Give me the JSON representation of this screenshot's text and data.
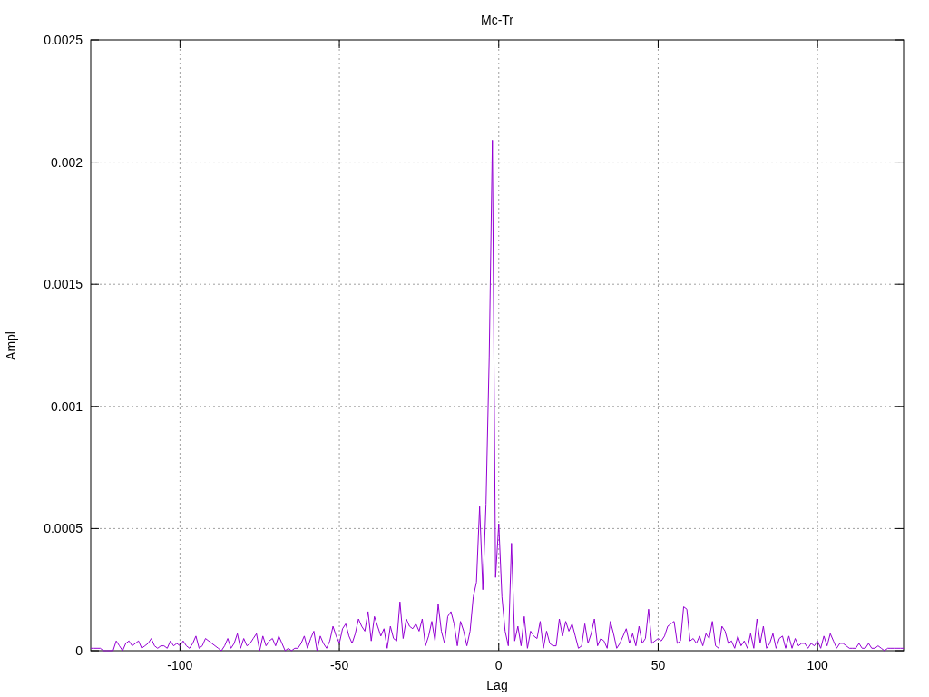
{
  "chart_data": {
    "type": "line",
    "title": "Mc-Tr",
    "xlabel": "Lag",
    "ylabel": "Ampl",
    "grid": true,
    "xlim": [
      -128,
      127
    ],
    "ylim": [
      0,
      0.0025
    ],
    "xticks": [
      -100,
      -50,
      0,
      50,
      100
    ],
    "yticks": [
      {
        "value": 0,
        "label": "0"
      },
      {
        "value": 0.0005,
        "label": "0.0005"
      },
      {
        "value": 0.001,
        "label": "0.001"
      },
      {
        "value": 0.0015,
        "label": "0.0015"
      },
      {
        "value": 0.002,
        "label": "0.002"
      },
      {
        "value": 0.0025,
        "label": "0.0025"
      }
    ],
    "x": [
      -128,
      -127,
      -126,
      -125,
      -124,
      -123,
      -122,
      -121,
      -120,
      -119,
      -118,
      -117,
      -116,
      -115,
      -114,
      -113,
      -112,
      -111,
      -110,
      -109,
      -108,
      -107,
      -106,
      -105,
      -104,
      -103,
      -102,
      -101,
      -100,
      -99,
      -98,
      -97,
      -96,
      -95,
      -94,
      -93,
      -92,
      -91,
      -90,
      -89,
      -88,
      -87,
      -86,
      -85,
      -84,
      -83,
      -82,
      -81,
      -80,
      -79,
      -78,
      -77,
      -76,
      -75,
      -74,
      -73,
      -72,
      -71,
      -70,
      -69,
      -68,
      -67,
      -66,
      -65,
      -64,
      -63,
      -62,
      -61,
      -60,
      -59,
      -58,
      -57,
      -56,
      -55,
      -54,
      -53,
      -52,
      -51,
      -50,
      -49,
      -48,
      -47,
      -46,
      -45,
      -44,
      -43,
      -42,
      -41,
      -40,
      -39,
      -38,
      -37,
      -36,
      -35,
      -34,
      -33,
      -32,
      -31,
      -30,
      -29,
      -28,
      -27,
      -26,
      -25,
      -24,
      -23,
      -22,
      -21,
      -20,
      -19,
      -18,
      -17,
      -16,
      -15,
      -14,
      -13,
      -12,
      -11,
      -10,
      -9,
      -8,
      -7,
      -6,
      -5,
      -4,
      -3,
      -2,
      -1,
      0,
      1,
      2,
      3,
      4,
      5,
      6,
      7,
      8,
      9,
      10,
      11,
      12,
      13,
      14,
      15,
      16,
      17,
      18,
      19,
      20,
      21,
      22,
      23,
      24,
      25,
      26,
      27,
      28,
      29,
      30,
      31,
      32,
      33,
      34,
      35,
      36,
      37,
      38,
      39,
      40,
      41,
      42,
      43,
      44,
      45,
      46,
      47,
      48,
      49,
      50,
      51,
      52,
      53,
      54,
      55,
      56,
      57,
      58,
      59,
      60,
      61,
      62,
      63,
      64,
      65,
      66,
      67,
      68,
      69,
      70,
      71,
      72,
      73,
      74,
      75,
      76,
      77,
      78,
      79,
      80,
      81,
      82,
      83,
      84,
      85,
      86,
      87,
      88,
      89,
      90,
      91,
      92,
      93,
      94,
      95,
      96,
      97,
      98,
      99,
      100,
      101,
      102,
      103,
      104,
      105,
      106,
      107,
      108,
      109,
      110,
      111,
      112,
      113,
      114,
      115,
      116,
      117,
      118,
      119,
      120,
      121,
      122,
      123,
      124,
      125,
      126,
      127
    ],
    "series": [
      {
        "color": "#9400d3",
        "values": [
          1e-05,
          1e-05,
          1e-05,
          1e-05,
          0,
          0,
          0,
          0,
          4e-05,
          2e-05,
          0,
          3e-05,
          4e-05,
          2e-05,
          3e-05,
          4e-05,
          1e-05,
          2e-05,
          3e-05,
          5e-05,
          2e-05,
          1e-05,
          2e-05,
          2e-05,
          1e-05,
          4e-05,
          2e-05,
          3e-05,
          2e-05,
          4e-05,
          2e-05,
          1e-05,
          3e-05,
          6e-05,
          1e-05,
          2e-05,
          5e-05,
          4e-05,
          3e-05,
          2e-05,
          1e-05,
          0,
          2e-05,
          5e-05,
          1e-05,
          3e-05,
          7e-05,
          1e-05,
          5e-05,
          2e-05,
          3e-05,
          5e-05,
          7e-05,
          0,
          6e-05,
          2e-05,
          4e-05,
          5e-05,
          2e-05,
          6e-05,
          3e-05,
          0,
          1e-05,
          0,
          1e-05,
          1e-05,
          3e-05,
          6e-05,
          1e-05,
          5e-05,
          8e-05,
          0,
          6e-05,
          3e-05,
          1e-05,
          4e-05,
          0.0001,
          6e-05,
          3e-05,
          9e-05,
          0.00011,
          6e-05,
          3e-05,
          7e-05,
          0.00013,
          0.0001,
          8e-05,
          0.00016,
          4e-05,
          0.00014,
          0.0001,
          6e-05,
          9e-05,
          1e-05,
          0.0001,
          5e-05,
          4e-05,
          0.0002,
          5e-05,
          0.00013,
          0.0001,
          9e-05,
          0.00011,
          8e-05,
          0.00013,
          2e-05,
          6e-05,
          0.00012,
          4e-05,
          0.00019,
          8e-05,
          3e-05,
          0.00014,
          0.00016,
          0.00011,
          2e-05,
          0.00012,
          8e-05,
          2e-05,
          8e-05,
          0.00022,
          0.00028,
          0.00059,
          0.00025,
          0.0006,
          0.0012,
          0.00209,
          0.0003,
          0.00052,
          0.00022,
          8e-05,
          2e-05,
          0.00044,
          4e-05,
          0.0001,
          2e-05,
          0.00014,
          1e-05,
          8e-05,
          6e-05,
          5e-05,
          0.00012,
          1e-05,
          8e-05,
          3e-05,
          2e-05,
          2e-05,
          0.00013,
          6e-05,
          0.00012,
          8e-05,
          0.00011,
          6e-05,
          1e-05,
          2e-05,
          0.00011,
          3e-05,
          7e-05,
          0.00013,
          2e-05,
          5e-05,
          4e-05,
          1e-05,
          0.00012,
          7e-05,
          1e-05,
          3e-05,
          6e-05,
          9e-05,
          3e-05,
          7e-05,
          2e-05,
          0.0001,
          3e-05,
          5e-05,
          0.00017,
          3e-05,
          4e-05,
          5e-05,
          4e-05,
          6e-05,
          0.0001,
          0.00011,
          0.00012,
          3e-05,
          4e-05,
          0.00018,
          0.00017,
          4e-05,
          5e-05,
          3e-05,
          6e-05,
          2e-05,
          7e-05,
          5e-05,
          0.00012,
          2e-05,
          1e-05,
          0.0001,
          8e-05,
          3e-05,
          4e-05,
          1e-05,
          6e-05,
          2e-05,
          4e-05,
          1e-05,
          7e-05,
          1e-05,
          0.00013,
          3e-05,
          0.0001,
          1e-05,
          3e-05,
          7e-05,
          1e-05,
          5e-05,
          6e-05,
          1e-05,
          6e-05,
          1e-05,
          5e-05,
          2e-05,
          3e-05,
          3e-05,
          1e-05,
          3e-05,
          2e-05,
          4e-05,
          1e-05,
          6e-05,
          2e-05,
          7e-05,
          4e-05,
          1e-05,
          3e-05,
          3e-05,
          2e-05,
          1e-05,
          1e-05,
          1e-05,
          3e-05,
          1e-05,
          1e-05,
          3e-05,
          1e-05,
          1e-05,
          2e-05,
          1e-05,
          0,
          1e-05,
          1e-05,
          1e-05,
          1e-05,
          1e-05,
          1e-05
        ]
      }
    ]
  }
}
